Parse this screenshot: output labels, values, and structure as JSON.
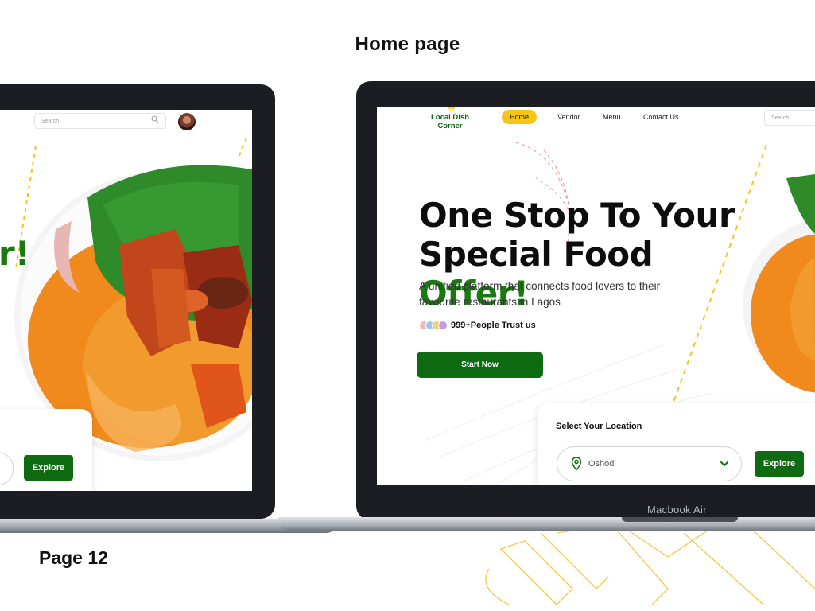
{
  "page": {
    "heading": "Home page",
    "page_number": "Page 12"
  },
  "device": {
    "model_label": "Macbook Air"
  },
  "left_screen": {
    "search_placeholder": "Search",
    "headline_fragment": "r!",
    "explore_label": "Explore"
  },
  "right_screen": {
    "brand": "Local Dish Corner",
    "nav": [
      {
        "label": "Home",
        "active": true
      },
      {
        "label": "Vendor",
        "active": false
      },
      {
        "label": "Menu",
        "active": false
      },
      {
        "label": "Contact Us",
        "active": false
      }
    ],
    "search_placeholder": "Search",
    "headline": {
      "line1": "One Stop To Your",
      "line2_start": "Special Food ",
      "line2_accent": "Offer!"
    },
    "subtitle": "A unified platform that connects food lovers to their favourite restaurants in Lagos",
    "trust_text": "999+People Trust us",
    "start_label": "Start Now",
    "location": {
      "title": "Select Your Location",
      "selected": "Oshodi",
      "explore_label": "Explore"
    }
  },
  "icons": [
    "search-icon",
    "chevron-down-icon",
    "map-pin-icon",
    "user-avatar"
  ],
  "colors": {
    "brand_green": "#0f6b12",
    "accent_green": "#1a7a12",
    "accent_yellow": "#f5c518",
    "device_frame": "#1b1d23"
  }
}
